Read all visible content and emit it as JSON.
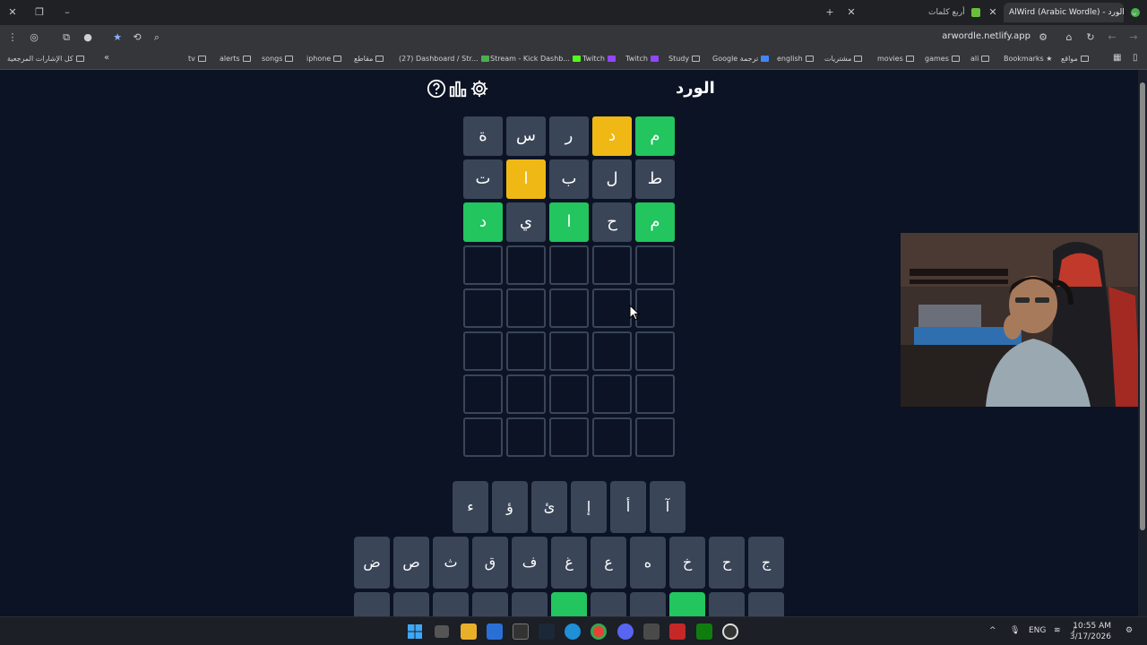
{
  "tabs": {
    "active_title": "AlWird (Arabic Wordle) - الورد",
    "other_title": "أربع كلمات"
  },
  "address": {
    "url": "arwordle.netlify.app"
  },
  "bookmarks": [
    "كل الإشارات المرجعية",
    "tv",
    "alerts",
    "songs",
    "iphone",
    "مقاطع",
    "(27) Dashboard / Str...",
    "Stream - Kick Dashb...",
    "Twitch",
    "Twitch",
    "Study",
    "Google ترجمة",
    "english",
    "مشتريات",
    "movies",
    "games",
    "ali",
    "Bookmarks",
    "مواقع"
  ],
  "game": {
    "title": "الورد",
    "rows": [
      [
        {
          "l": "م",
          "s": "correct"
        },
        {
          "l": "د",
          "s": "present"
        },
        {
          "l": "ر",
          "s": "absent"
        },
        {
          "l": "س",
          "s": "absent"
        },
        {
          "l": "ة",
          "s": "absent"
        }
      ],
      [
        {
          "l": "ط",
          "s": "absent"
        },
        {
          "l": "ل",
          "s": "absent"
        },
        {
          "l": "ب",
          "s": "absent"
        },
        {
          "l": "ا",
          "s": "present"
        },
        {
          "l": "ت",
          "s": "absent"
        }
      ],
      [
        {
          "l": "م",
          "s": "correct"
        },
        {
          "l": "ح",
          "s": "absent"
        },
        {
          "l": "ا",
          "s": "correct"
        },
        {
          "l": "ي",
          "s": "absent"
        },
        {
          "l": "د",
          "s": "correct"
        }
      ]
    ],
    "empty_rows": 5
  },
  "keyboard": {
    "row1": [
      "آ",
      "أ",
      "إ",
      "ئ",
      "ؤ",
      "ء"
    ],
    "row2": [
      "ج",
      "ح",
      "خ",
      "ه",
      "ع",
      "غ",
      "ف",
      "ق",
      "ث",
      "ص",
      "ض"
    ],
    "row3": [
      {
        "l": "",
        "s": "absent"
      },
      {
        "l": "",
        "s": "absent"
      },
      {
        "l": "",
        "s": "correct"
      },
      {
        "l": "",
        "s": "absent"
      },
      {
        "l": "",
        "s": "absent"
      },
      {
        "l": "",
        "s": "correct"
      },
      {
        "l": "",
        "s": "absent"
      },
      {
        "l": "",
        "s": "absent"
      },
      {
        "l": "",
        "s": "absent"
      },
      {
        "l": "",
        "s": "absent"
      },
      {
        "l": "",
        "s": "absent"
      }
    ]
  },
  "taskbar": {
    "lang": "ENG",
    "time": "10:55 AM",
    "date": "3/17/2026"
  },
  "colors": {
    "correct": "#22c55e",
    "present": "#f0b814",
    "absent": "#3a4558",
    "background": "#0b1324"
  }
}
